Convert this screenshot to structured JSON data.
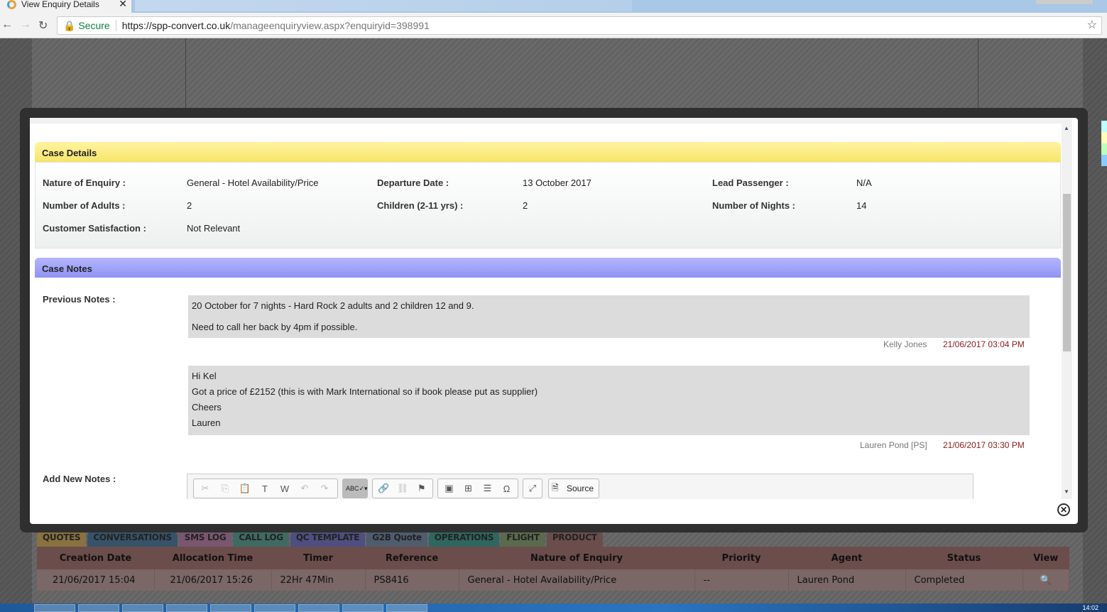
{
  "browser": {
    "tab_title": "View Enquiry Details",
    "security_label": "Secure",
    "url_host": "https://spp-convert.co.uk",
    "url_path": "/manageenquiryview.aspx?enquiryid=398991"
  },
  "case_details": {
    "title": "Case Details",
    "fields": [
      {
        "label": "Nature of Enquiry :",
        "value": "General - Hotel Availability/Price"
      },
      {
        "label": "Departure Date :",
        "value": "13 October 2017"
      },
      {
        "label": "Lead Passenger :",
        "value": "N/A"
      },
      {
        "label": "Number of Adults :",
        "value": "2"
      },
      {
        "label": "Children (2-11 yrs) :",
        "value": "2"
      },
      {
        "label": "Number of Nights :",
        "value": "14"
      },
      {
        "label": "Customer Satisfaction :",
        "value": "Not Relevant"
      }
    ]
  },
  "case_notes": {
    "title": "Case Notes",
    "previous_label": "Previous Notes :",
    "add_label": "Add New Notes :",
    "notes": [
      {
        "lines": [
          "20 October for 7 nights - Hard Rock 2 adults and 2 children 12 and 9.",
          "Need to call her back by 4pm if possible."
        ],
        "author": "Kelly Jones",
        "date": "21/06/2017 03:04 PM"
      },
      {
        "lines": [
          "Hi Kel",
          "Got a price of £2152 (this is with Mark International so if book please put as supplier)",
          "Cheers",
          "Lauren"
        ],
        "author": "Lauren Pond [PS]",
        "date": "21/06/2017 03:30 PM"
      }
    ]
  },
  "editor": {
    "source_label": "Source"
  },
  "bottom_tabs": [
    "QUOTES",
    "CONVERSATIONS",
    "SMS LOG",
    "CALL LOG",
    "QC TEMPLATE",
    "G2B Quote",
    "OPERATIONS",
    "FLIGHT",
    "PRODUCT"
  ],
  "table": {
    "headers": [
      "Creation Date",
      "Allocation Time",
      "Timer",
      "Reference",
      "Nature of Enquiry",
      "Priority",
      "Agent",
      "Status",
      "View"
    ],
    "row": [
      "21/06/2017 15:04",
      "21/06/2017 15:26",
      "22Hr 47Min",
      "PS8416",
      "General - Hotel Availability/Price",
      "--",
      "Lauren Pond",
      "Completed"
    ]
  },
  "taskbar": {
    "clock": "14:02"
  }
}
